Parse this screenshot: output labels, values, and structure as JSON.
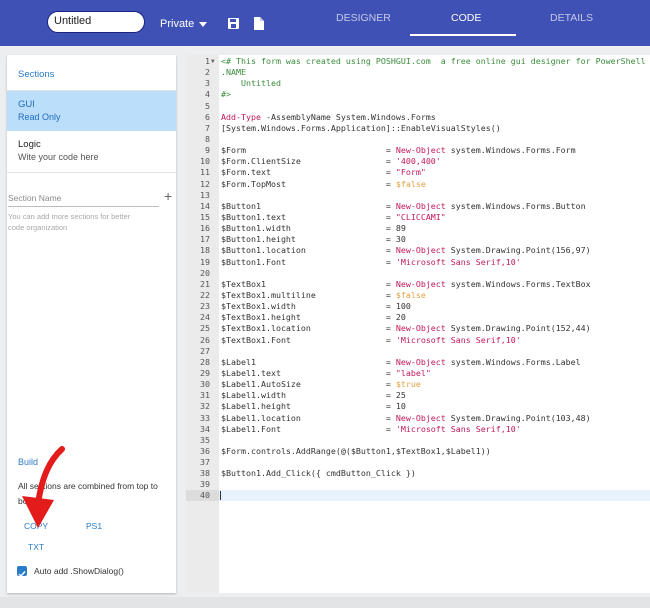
{
  "header": {
    "form_title": "Untitled",
    "visibility": "Private",
    "tabs": [
      {
        "label": "DESIGNER",
        "active": false
      },
      {
        "label": "CODE",
        "active": true
      },
      {
        "label": "DETAILS",
        "active": false
      }
    ],
    "colors": {
      "bar": "#3f51b5",
      "accent": "#2a7cc7"
    }
  },
  "sidebar": {
    "sections_label": "Sections",
    "items": [
      {
        "title": "GUI",
        "subtitle": "Read Only",
        "active": true
      },
      {
        "title": "Logic",
        "subtitle": "Wite your code here",
        "active": false
      }
    ],
    "section_name_placeholder": "Section Name",
    "section_help": "You can add more sections for better code organization",
    "build": {
      "title": "Build",
      "description": "All sections are combined from top to bottom",
      "buttons": [
        "COPY",
        "PS1",
        "TXT"
      ],
      "auto_add_label": "Auto add .ShowDialog()",
      "auto_add_checked": true
    }
  },
  "editor": {
    "active_line": 40,
    "lines": [
      {
        "n": 1,
        "fold": true,
        "parts": [
          {
            "t": "<# This form was created using POSHGUI.com  a free online gui designer for PowerShell",
            "c": "c-comment"
          }
        ]
      },
      {
        "n": 2,
        "parts": [
          {
            "t": ".NAME",
            "c": "c-comment"
          }
        ]
      },
      {
        "n": 3,
        "parts": [
          {
            "t": "    Untitled",
            "c": "c-comment"
          }
        ]
      },
      {
        "n": 4,
        "parts": [
          {
            "t": "#>",
            "c": "c-comment"
          }
        ]
      },
      {
        "n": 5,
        "parts": []
      },
      {
        "n": 6,
        "parts": [
          {
            "t": "Add-Type",
            "c": "c-cmd"
          },
          {
            "t": " -AssemblyName System.Windows.Forms",
            "c": "c-var"
          }
        ]
      },
      {
        "n": 7,
        "parts": [
          {
            "t": "[System.Windows.Forms.Application]::EnableVisualStyles()",
            "c": "c-var"
          }
        ]
      },
      {
        "n": 8,
        "parts": []
      },
      {
        "n": 9,
        "parts": [
          {
            "t": "$Form                            = ",
            "c": "c-var"
          },
          {
            "t": "New-Object",
            "c": "c-cmd"
          },
          {
            "t": " system.Windows.Forms.Form",
            "c": "c-var"
          }
        ]
      },
      {
        "n": 10,
        "parts": [
          {
            "t": "$Form.ClientSize                 = ",
            "c": "c-var"
          },
          {
            "t": "'400,400'",
            "c": "c-str"
          }
        ]
      },
      {
        "n": 11,
        "parts": [
          {
            "t": "$Form.text                       = ",
            "c": "c-var"
          },
          {
            "t": "\"Form\"",
            "c": "c-str"
          }
        ]
      },
      {
        "n": 12,
        "parts": [
          {
            "t": "$Form.TopMost                    = ",
            "c": "c-var"
          },
          {
            "t": "$false",
            "c": "c-bool"
          }
        ]
      },
      {
        "n": 13,
        "parts": []
      },
      {
        "n": 14,
        "parts": [
          {
            "t": "$Button1                         = ",
            "c": "c-var"
          },
          {
            "t": "New-Object",
            "c": "c-cmd"
          },
          {
            "t": " system.Windows.Forms.Button",
            "c": "c-var"
          }
        ]
      },
      {
        "n": 15,
        "parts": [
          {
            "t": "$Button1.text                    = ",
            "c": "c-var"
          },
          {
            "t": "\"CLICCAMI\"",
            "c": "c-str"
          }
        ]
      },
      {
        "n": 16,
        "parts": [
          {
            "t": "$Button1.width                   = 89",
            "c": "c-var"
          }
        ]
      },
      {
        "n": 17,
        "parts": [
          {
            "t": "$Button1.height                  = 30",
            "c": "c-var"
          }
        ]
      },
      {
        "n": 18,
        "parts": [
          {
            "t": "$Button1.location                = ",
            "c": "c-var"
          },
          {
            "t": "New-Object",
            "c": "c-cmd"
          },
          {
            "t": " System.Drawing.Point(156,97)",
            "c": "c-var"
          }
        ]
      },
      {
        "n": 19,
        "parts": [
          {
            "t": "$Button1.Font                    = ",
            "c": "c-var"
          },
          {
            "t": "'Microsoft Sans Serif,10'",
            "c": "c-str"
          }
        ]
      },
      {
        "n": 20,
        "parts": []
      },
      {
        "n": 21,
        "parts": [
          {
            "t": "$TextBox1                        = ",
            "c": "c-var"
          },
          {
            "t": "New-Object",
            "c": "c-cmd"
          },
          {
            "t": " system.Windows.Forms.TextBox",
            "c": "c-var"
          }
        ]
      },
      {
        "n": 22,
        "parts": [
          {
            "t": "$TextBox1.multiline              = ",
            "c": "c-var"
          },
          {
            "t": "$false",
            "c": "c-bool"
          }
        ]
      },
      {
        "n": 23,
        "parts": [
          {
            "t": "$TextBox1.width                  = 100",
            "c": "c-var"
          }
        ]
      },
      {
        "n": 24,
        "parts": [
          {
            "t": "$TextBox1.height                 = 20",
            "c": "c-var"
          }
        ]
      },
      {
        "n": 25,
        "parts": [
          {
            "t": "$TextBox1.location               = ",
            "c": "c-var"
          },
          {
            "t": "New-Object",
            "c": "c-cmd"
          },
          {
            "t": " System.Drawing.Point(152,44)",
            "c": "c-var"
          }
        ]
      },
      {
        "n": 26,
        "parts": [
          {
            "t": "$TextBox1.Font                   = ",
            "c": "c-var"
          },
          {
            "t": "'Microsoft Sans Serif,10'",
            "c": "c-str"
          }
        ]
      },
      {
        "n": 27,
        "parts": []
      },
      {
        "n": 28,
        "parts": [
          {
            "t": "$Label1                          = ",
            "c": "c-var"
          },
          {
            "t": "New-Object",
            "c": "c-cmd"
          },
          {
            "t": " system.Windows.Forms.Label",
            "c": "c-var"
          }
        ]
      },
      {
        "n": 29,
        "parts": [
          {
            "t": "$Label1.text                     = ",
            "c": "c-var"
          },
          {
            "t": "\"label\"",
            "c": "c-str"
          }
        ]
      },
      {
        "n": 30,
        "parts": [
          {
            "t": "$Label1.AutoSize                 = ",
            "c": "c-var"
          },
          {
            "t": "$true",
            "c": "c-bool"
          }
        ]
      },
      {
        "n": 31,
        "parts": [
          {
            "t": "$Label1.width                    = 25",
            "c": "c-var"
          }
        ]
      },
      {
        "n": 32,
        "parts": [
          {
            "t": "$Label1.height                   = 10",
            "c": "c-var"
          }
        ]
      },
      {
        "n": 33,
        "parts": [
          {
            "t": "$Label1.location                 = ",
            "c": "c-var"
          },
          {
            "t": "New-Object",
            "c": "c-cmd"
          },
          {
            "t": " System.Drawing.Point(103,48)",
            "c": "c-var"
          }
        ]
      },
      {
        "n": 34,
        "parts": [
          {
            "t": "$Label1.Font                     = ",
            "c": "c-var"
          },
          {
            "t": "'Microsoft Sans Serif,10'",
            "c": "c-str"
          }
        ]
      },
      {
        "n": 35,
        "parts": []
      },
      {
        "n": 36,
        "parts": [
          {
            "t": "$Form.controls.AddRange(@($Button1,$TextBox1,$Label1))",
            "c": "c-var"
          }
        ]
      },
      {
        "n": 37,
        "parts": []
      },
      {
        "n": 38,
        "parts": [
          {
            "t": "$Button1.Add_Click({ cmdButton_Click })",
            "c": "c-var"
          }
        ]
      },
      {
        "n": 39,
        "parts": []
      },
      {
        "n": 40,
        "parts": []
      }
    ]
  }
}
